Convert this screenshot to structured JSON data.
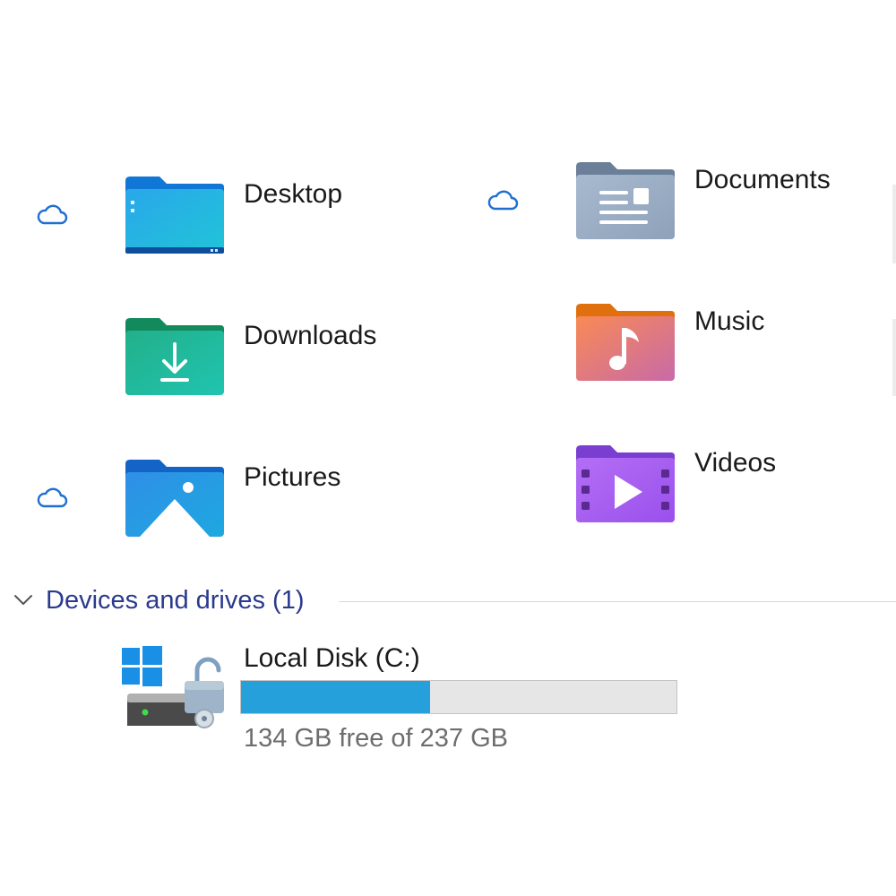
{
  "folders": [
    {
      "label": "Desktop",
      "icon": "desktop-folder-icon",
      "cloud": true,
      "color": "#1fa0e0"
    },
    {
      "label": "Documents",
      "icon": "documents-folder-icon",
      "cloud": true,
      "color": "#8fa6c0"
    },
    {
      "label": "Downloads",
      "icon": "downloads-folder-icon",
      "cloud": false,
      "color": "#1fb596"
    },
    {
      "label": "Music",
      "icon": "music-folder-icon",
      "cloud": false,
      "color": "#f0805a"
    },
    {
      "label": "Pictures",
      "icon": "pictures-folder-icon",
      "cloud": true,
      "color": "#2b8fe0"
    },
    {
      "label": "Videos",
      "icon": "videos-folder-icon",
      "cloud": false,
      "color": "#a45ff0"
    }
  ],
  "devices_section": {
    "title": "Devices and drives (1)",
    "icon": "chevron-down-icon"
  },
  "drive": {
    "label": "Local Disk (C:)",
    "free_text": "134 GB free of 237 GB",
    "used_fraction": 0.435,
    "bar_color": "#26a0da",
    "icon": "windows-drive-unlocked-icon"
  },
  "colors": {
    "accent": "#1f6fd1",
    "section_title": "#2b3a8f"
  }
}
